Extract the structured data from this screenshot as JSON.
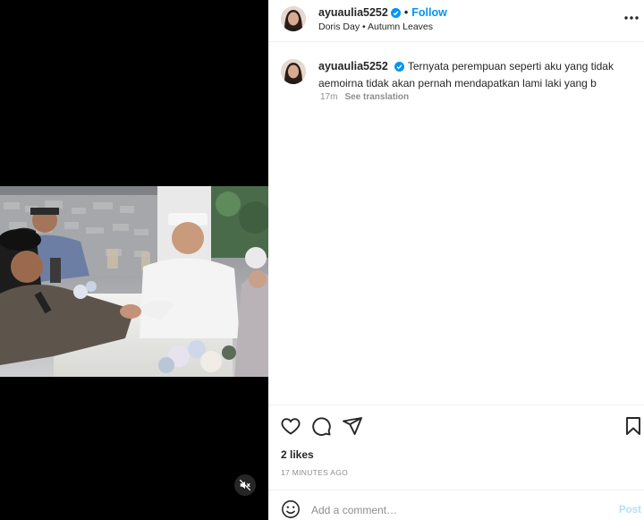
{
  "post": {
    "username": "ayuaulia5252",
    "follow_label": "Follow",
    "audio": {
      "artist": "Doris Day",
      "separator": "•",
      "track": "Autumn Leaves"
    }
  },
  "caption": {
    "username": "ayuaulia5252",
    "text": "Ternyata perempuan seperti aku yang tidak aemoirna tidak akan pernah mendapatkan lami laki yang b",
    "time": "17m",
    "see_translation": "See translation"
  },
  "engagement": {
    "likes": "2 likes",
    "time_ago": "17 MINUTES AGO"
  },
  "comment_box": {
    "placeholder": "Add a comment…",
    "post_label": "Post"
  },
  "colors": {
    "accent": "#0095f6",
    "text": "#262626",
    "muted": "#8e8e8e",
    "media_bg": "#000000"
  },
  "icons": [
    "verified-badge-icon",
    "more-options-icon",
    "heart-icon",
    "comment-icon",
    "share-icon",
    "bookmark-icon",
    "emoji-icon",
    "muted-audio-icon"
  ]
}
